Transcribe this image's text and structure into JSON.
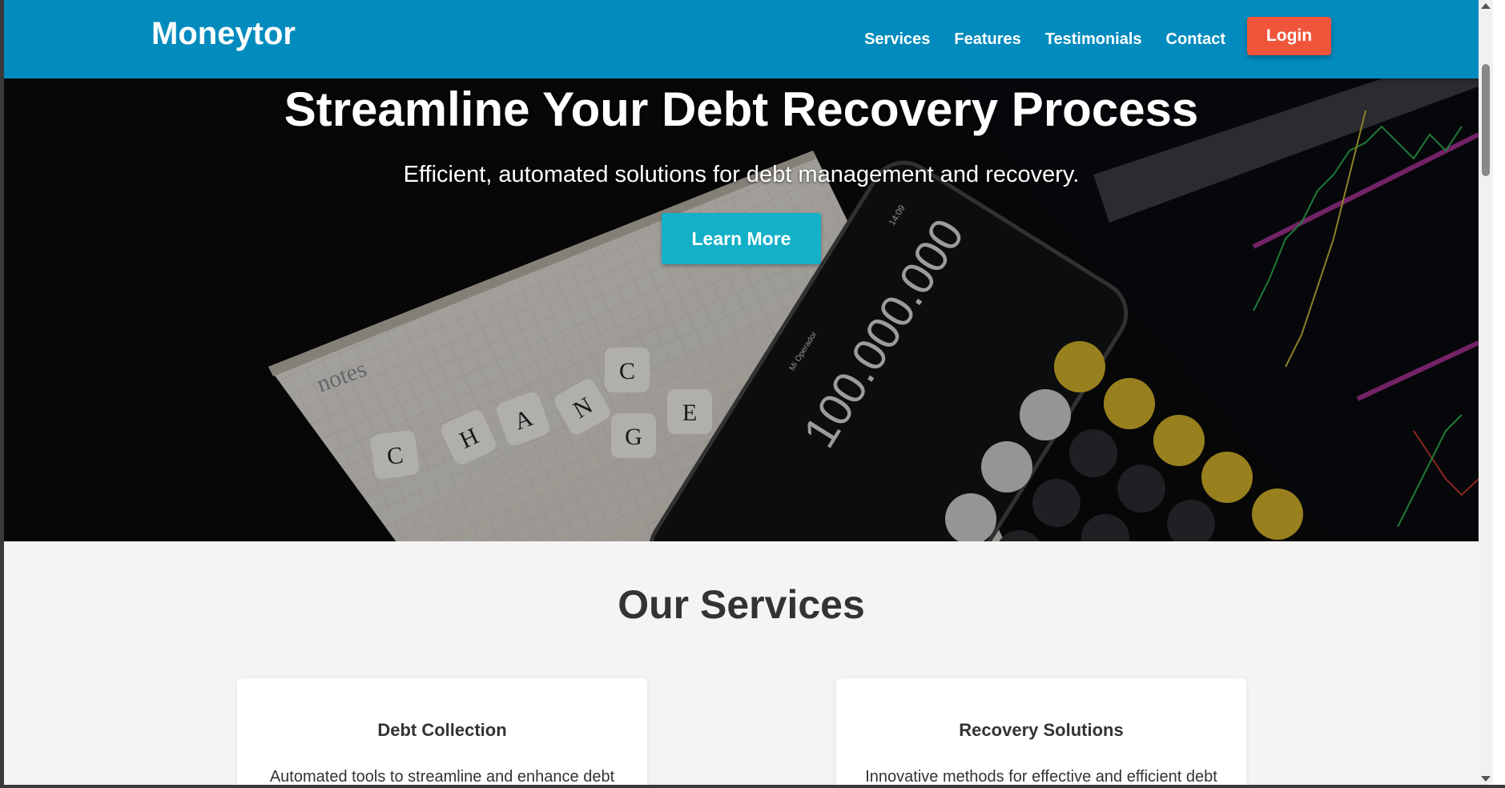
{
  "navbar": {
    "brand": "Moneytor",
    "links": [
      "Services",
      "Features",
      "Testimonials",
      "Contact"
    ],
    "login_label": "Login",
    "color": "#028bbd",
    "login_color": "#f0553b"
  },
  "hero": {
    "title": "Streamline Your Debt Recovery Process",
    "subtitle": "Efficient, automated solutions for debt management and recovery.",
    "cta_label": "Learn More",
    "cta_color": "#14b0c8",
    "image": {
      "notebook_label": "notes",
      "dice_letters": [
        "C",
        "H",
        "A",
        "N",
        "C",
        "G",
        "E"
      ],
      "calculator_display": "100.000.000",
      "phone_time": "14:09",
      "phone_carrier": "Mi Operador"
    }
  },
  "services": {
    "title": "Our Services",
    "cards": [
      {
        "title": "Debt Collection",
        "text": "Automated tools to streamline and enhance debt"
      },
      {
        "title": "Recovery Solutions",
        "text": "Innovative methods for effective and efficient debt"
      }
    ]
  }
}
